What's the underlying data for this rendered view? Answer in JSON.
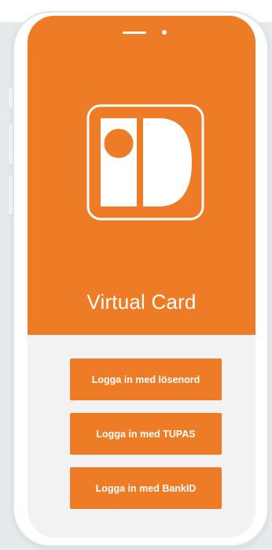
{
  "app": {
    "title": "Virtual Card",
    "logo_icon": "id-card-logo-icon"
  },
  "colors": {
    "brand_orange": "#ee7b26",
    "screen_background": "#f2f2f2",
    "button_text": "#ffffff"
  },
  "login": {
    "buttons": [
      {
        "label": "Logga in med lösenord"
      },
      {
        "label": "Logga in med TUPAS"
      },
      {
        "label": "Logga in med BankID"
      }
    ]
  }
}
